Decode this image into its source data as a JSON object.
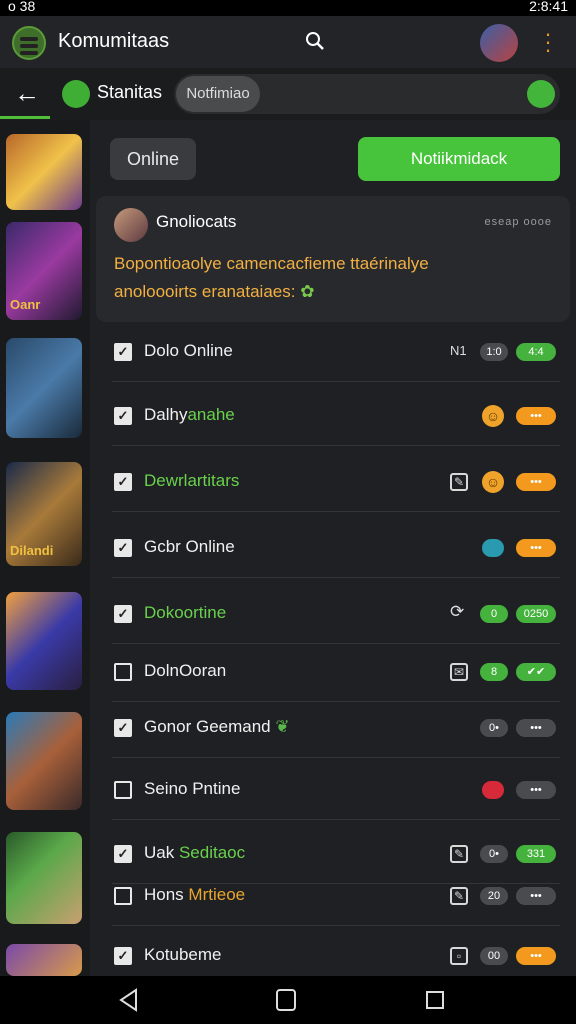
{
  "status_bar": {
    "left_text": "o 38",
    "right_text": "2:8:41"
  },
  "app_bar": {
    "title": "Komumitaas",
    "search_icon": "search-icon",
    "more_icon": "more-vert-icon"
  },
  "sub_bar": {
    "name": "Stanitas",
    "tag": "Notfimiao",
    "send_icon": "send-icon"
  },
  "actions": {
    "online_label": "Online",
    "primary_label": "Notiikmidack"
  },
  "post": {
    "title": "Gnoliocats",
    "meta": "eseap oooe",
    "body": "Bopontioaolye camencacfieme ttaérinalye anoloooirts eranataiaes:"
  },
  "rows": [
    {
      "label_parts": [
        {
          "text": "Dolo Online",
          "style": ""
        }
      ],
      "meta_text": "N1",
      "badges": [
        "1:0",
        "4:4"
      ]
    },
    {
      "label_parts": [
        {
          "text": "Dalhy",
          "style": ""
        },
        {
          "text": "anahe",
          "style": "g"
        }
      ],
      "badges": [
        "•••"
      ]
    },
    {
      "label_parts": [
        {
          "text": "Dewrlartitars",
          "style": "g"
        }
      ],
      "badges": [
        "•••"
      ]
    },
    {
      "label_parts": [
        {
          "text": "Gcbr Online",
          "style": ""
        }
      ],
      "badges": [
        "•••"
      ]
    },
    {
      "label_parts": [
        {
          "text": "Dokoortine",
          "style": "g"
        }
      ],
      "badges": [
        "0",
        "0250"
      ]
    },
    {
      "label_parts": [
        {
          "text": "DolnOoran",
          "style": ""
        }
      ],
      "badges": [
        "8",
        "✔✔"
      ]
    },
    {
      "label_parts": [
        {
          "text": "Gonor Geemand",
          "style": ""
        }
      ],
      "badges": [
        "0•",
        "•••"
      ]
    },
    {
      "label_parts": [
        {
          "text": "Seino Pntine",
          "style": ""
        }
      ],
      "badges": [
        "•••"
      ]
    },
    {
      "label_parts": [
        {
          "text": "Uak ",
          "style": ""
        },
        {
          "text": "Seditaoc",
          "style": "g"
        }
      ],
      "badges": [
        "0•",
        "331"
      ]
    },
    {
      "label_parts": [
        {
          "text": "Hons ",
          "style": ""
        },
        {
          "text": "Mrtieoe",
          "style": "o"
        }
      ],
      "badges": [
        "20",
        "•••"
      ]
    },
    {
      "label_parts": [
        {
          "text": "Kotubeme",
          "style": ""
        }
      ],
      "badges": [
        "00",
        "•••"
      ]
    }
  ],
  "sidebar": {
    "thumb_caption_1": "Oanr",
    "thumb_caption_2": "Dilandi"
  },
  "colors": {
    "accent_green": "#48c43c",
    "accent_orange": "#f39a1e",
    "bg": "#1f2023"
  }
}
